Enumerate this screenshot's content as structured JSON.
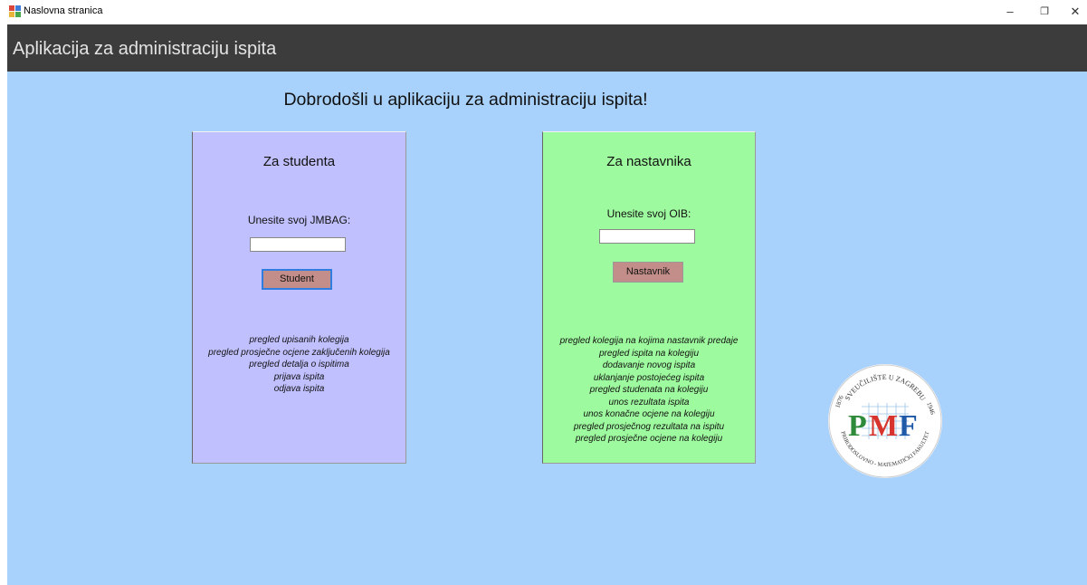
{
  "window": {
    "title": "Naslovna stranica",
    "minimize": "–",
    "maximize": "❐",
    "close": "✕"
  },
  "header": {
    "title": "Aplikacija za administraciju ispita"
  },
  "welcome": "Dobrodošli u aplikaciju za administraciju ispita!",
  "student": {
    "title": "Za studenta",
    "prompt": "Unesite svoj JMBAG:",
    "input_value": "",
    "button": "Student",
    "features": [
      "pregled upisanih kolegija",
      "pregled prosječne ocjene zaključenih kolegija",
      "pregled detalja o ispitima",
      "prijava ispita",
      "odjava ispita"
    ]
  },
  "teacher": {
    "title": "Za nastavnika",
    "prompt": "Unesite svoj OIB:",
    "input_value": "",
    "button": "Nastavnik",
    "features": [
      "pregled kolegija na kojima nastavnik predaje",
      "pregled ispita na kolegiju",
      "dodavanje novog ispita",
      "uklanjanje postojećeg ispita",
      "pregled studenata na kolegiju",
      "unos rezultata ispita",
      "unos konačne ocjene na kolegiju",
      "pregled prosječnog rezultata na ispitu",
      "pregled prosječne ocjene na kolegiju"
    ]
  },
  "logo": {
    "letters": [
      "P",
      "M",
      "F"
    ],
    "ring_top": "SVEUČILIŠTE U ZAGREBU",
    "ring_bottom": "PRIRODOSLOVNO - MATEMATIČKI FAKULTET",
    "year_left": "1876",
    "year_right": "1946",
    "colors": {
      "P": "#2e8b3a",
      "M": "#d6342c",
      "F": "#1e5aa8",
      "grid": "#9ec4e8"
    }
  },
  "colors": {
    "header_bg": "#3c3c3c",
    "main_bg": "#a8d1fb",
    "student_panel": "#c1c0ff",
    "teacher_panel": "#9efa9e",
    "button_bg": "#c38e89"
  }
}
